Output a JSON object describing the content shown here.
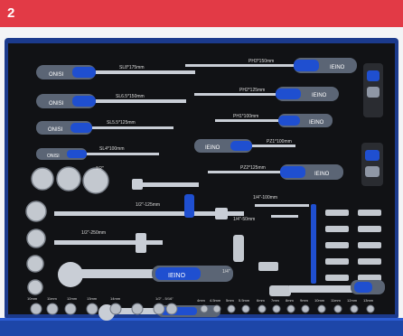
{
  "header": {
    "number": "2"
  },
  "photo": {
    "screwdrivers": [
      {
        "brand": "ONISI",
        "size": "SL8*175mm"
      },
      {
        "brand": "ONISI",
        "size": "SL6.5*150mm"
      },
      {
        "brand": "ONISI",
        "size": "SL5.5*125mm"
      },
      {
        "brand": "ONISI",
        "size": "SL4*100mm"
      },
      {
        "brand": "IEINO",
        "size": "PH3*150mm"
      },
      {
        "brand": "IEINO",
        "size": "PH2*125mm"
      },
      {
        "brand": "IEINO",
        "size": "PH1*100mm"
      },
      {
        "brand": "IEINO",
        "size": "PZ1*100mm"
      },
      {
        "brand": "IEINO",
        "size": "PZ2*125mm"
      }
    ],
    "labels": {
      "half_inch": "1/2\"",
      "ext_125": "1/2\"-125mm",
      "ext_250": "1/2\"-250mm",
      "quarter_ext_100": "1/4\"-100mm",
      "quarter_ext_50": "1/4\"-50mm",
      "quarter": "1/4\"",
      "ratchet_brand": "IEINO",
      "joint_label": "1/2\" - 5/16\"",
      "small_sockets": [
        "4mm",
        "4.5mm",
        "5mm",
        "5.5mm",
        "6mm",
        "7mm",
        "8mm",
        "9mm",
        "10mm",
        "11mm",
        "12mm",
        "13mm"
      ],
      "big_sockets": [
        "10mm",
        "11mm",
        "12mm",
        "13mm",
        "14mm"
      ]
    }
  }
}
